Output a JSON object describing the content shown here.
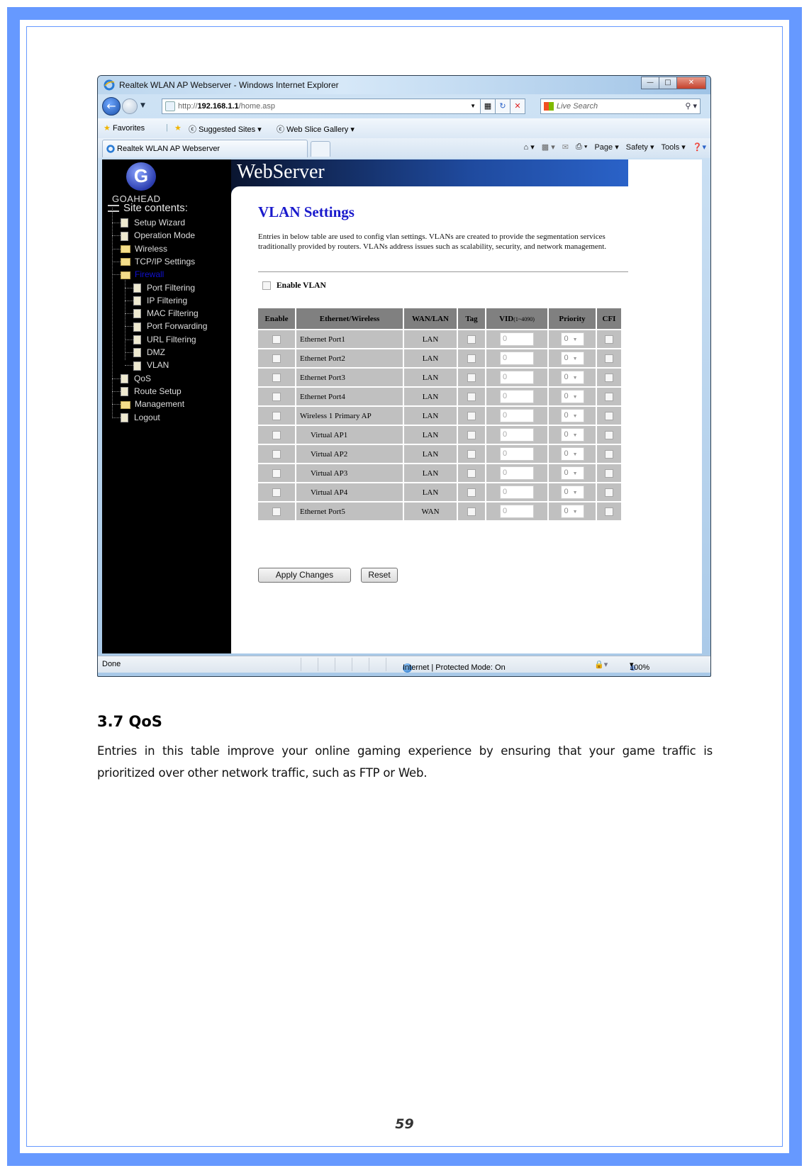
{
  "browser": {
    "window_title": "Realtek WLAN AP Webserver - Windows Internet Explorer",
    "address": {
      "protocol": "http://",
      "host": "192.168.1.1",
      "path": "/home.asp"
    },
    "search_placeholder": "Live Search",
    "favorites_label": "Favorites",
    "favorites_links": [
      "Suggested Sites ▾",
      "Web Slice Gallery ▾"
    ],
    "tab_label": "Realtek WLAN AP Webserver",
    "command_bar": [
      "Page ▾",
      "Safety ▾",
      "Tools ▾"
    ],
    "window_buttons": [
      "minimize",
      "maximize",
      "close"
    ],
    "status": {
      "left": "Done",
      "zone": "Internet | Protected Mode: On",
      "zoom": "100%"
    }
  },
  "webapp": {
    "brand": "GoAhead",
    "header_title": "WebServer",
    "tree": {
      "root": "Site contents:",
      "items": [
        {
          "label": "Setup Wizard",
          "type": "doc",
          "level": 1
        },
        {
          "label": "Operation Mode",
          "type": "doc",
          "level": 1
        },
        {
          "label": "Wireless",
          "type": "folder",
          "level": 1
        },
        {
          "label": "TCP/IP Settings",
          "type": "folder",
          "level": 1
        },
        {
          "label": "Firewall",
          "type": "folder-open",
          "level": 1,
          "active": true
        },
        {
          "label": "Port Filtering",
          "type": "doc",
          "level": 2
        },
        {
          "label": "IP Filtering",
          "type": "doc",
          "level": 2
        },
        {
          "label": "MAC Filtering",
          "type": "doc",
          "level": 2
        },
        {
          "label": "Port Forwarding",
          "type": "doc",
          "level": 2
        },
        {
          "label": "URL Filtering",
          "type": "doc",
          "level": 2
        },
        {
          "label": "DMZ",
          "type": "doc",
          "level": 2
        },
        {
          "label": "VLAN",
          "type": "doc",
          "level": 2
        },
        {
          "label": "QoS",
          "type": "doc",
          "level": 1
        },
        {
          "label": "Route Setup",
          "type": "doc",
          "level": 1
        },
        {
          "label": "Management",
          "type": "folder",
          "level": 1
        },
        {
          "label": "Logout",
          "type": "doc",
          "level": 1
        }
      ]
    },
    "page_title": "VLAN Settings",
    "description": "Entries in below table are used to config vlan settings. VLANs are created to provide the segmentation services traditionally provided by routers. VLANs address issues such as scalability, security, and network management.",
    "enable_vlan_label": "Enable VLAN",
    "enable_vlan_checked": false,
    "table": {
      "headers": [
        "Enable",
        "Ethernet/Wireless",
        "WAN/LAN",
        "Tag",
        "VID",
        "Priority",
        "CFI"
      ],
      "vid_range": "(1~4090)",
      "rows": [
        {
          "name": "Ethernet Port1",
          "indent": false,
          "wanlan": "LAN",
          "vid": "0",
          "priority": "0"
        },
        {
          "name": "Ethernet Port2",
          "indent": false,
          "wanlan": "LAN",
          "vid": "0",
          "priority": "0"
        },
        {
          "name": "Ethernet Port3",
          "indent": false,
          "wanlan": "LAN",
          "vid": "0",
          "priority": "0"
        },
        {
          "name": "Ethernet Port4",
          "indent": false,
          "wanlan": "LAN",
          "vid": "0",
          "priority": "0"
        },
        {
          "name": "Wireless 1 Primary AP",
          "indent": false,
          "wanlan": "LAN",
          "vid": "0",
          "priority": "0"
        },
        {
          "name": "Virtual AP1",
          "indent": true,
          "wanlan": "LAN",
          "vid": "0",
          "priority": "0"
        },
        {
          "name": "Virtual AP2",
          "indent": true,
          "wanlan": "LAN",
          "vid": "0",
          "priority": "0"
        },
        {
          "name": "Virtual AP3",
          "indent": true,
          "wanlan": "LAN",
          "vid": "0",
          "priority": "0"
        },
        {
          "name": "Virtual AP4",
          "indent": true,
          "wanlan": "LAN",
          "vid": "0",
          "priority": "0"
        },
        {
          "name": "Ethernet Port5",
          "indent": false,
          "wanlan": "WAN",
          "vid": "0",
          "priority": "0"
        }
      ]
    },
    "buttons": {
      "apply": "Apply Changes",
      "reset": "Reset"
    }
  },
  "document": {
    "section_title": "3.7  QoS",
    "section_body": "Entries in this table improve your online gaming experience by ensuring that your game traffic is prioritized over other network traffic, such as FTP or Web.",
    "page_number": "59"
  },
  "colors": {
    "frame": "#6699ff",
    "page_title": "#1a1acc",
    "table_header": "#808080",
    "table_cell": "#c0c0c0"
  }
}
